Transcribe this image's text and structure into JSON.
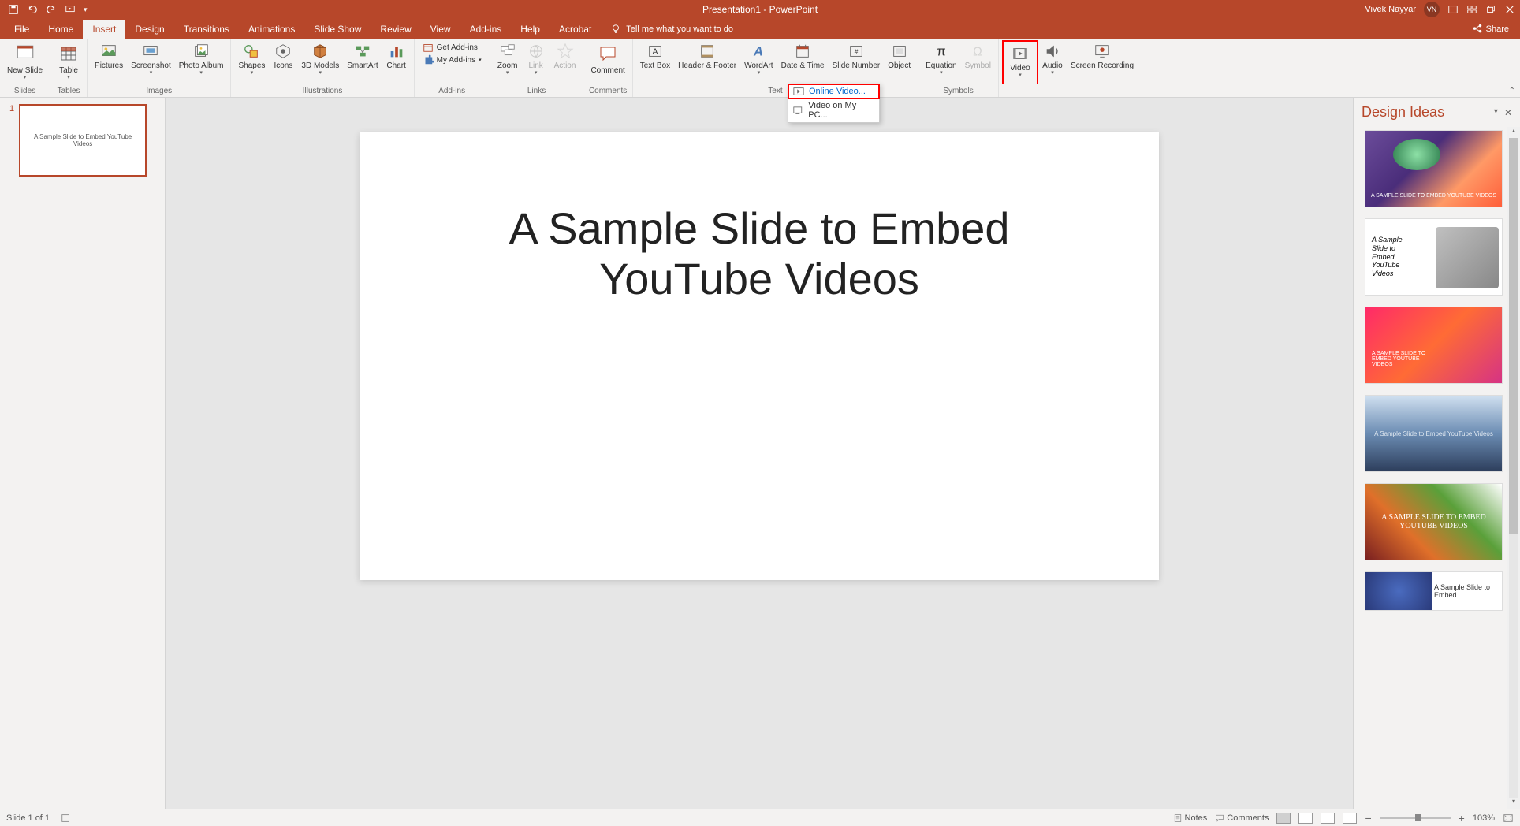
{
  "app": {
    "title": "Presentation1 - PowerPoint",
    "user": "Vivek Nayyar",
    "initials": "VN"
  },
  "qat": {
    "save": "Save",
    "undo": "Undo",
    "redo": "Redo",
    "start": "Start From Beginning"
  },
  "tabs": [
    "File",
    "Home",
    "Insert",
    "Design",
    "Transitions",
    "Animations",
    "Slide Show",
    "Review",
    "View",
    "Add-ins",
    "Help",
    "Acrobat"
  ],
  "active_tab": "Insert",
  "tellme": "Tell me what you want to do",
  "share": "Share",
  "ribbon_groups": {
    "slides": {
      "label": "Slides",
      "new_slide": "New\nSlide"
    },
    "tables": {
      "label": "Tables",
      "table": "Table"
    },
    "images": {
      "label": "Images",
      "pictures": "Pictures",
      "screenshot": "Screenshot",
      "photo_album": "Photo\nAlbum"
    },
    "illustrations": {
      "label": "Illustrations",
      "shapes": "Shapes",
      "icons": "Icons",
      "models3d": "3D\nModels",
      "smartart": "SmartArt",
      "chart": "Chart"
    },
    "addins": {
      "label": "Add-ins",
      "get": "Get Add-ins",
      "my": "My Add-ins"
    },
    "links": {
      "label": "Links",
      "zoom": "Zoom",
      "link": "Link",
      "action": "Action"
    },
    "comments": {
      "label": "Comments",
      "comment": "Comment"
    },
    "text": {
      "label": "Text",
      "textbox": "Text\nBox",
      "header": "Header\n& Footer",
      "wordart": "WordArt",
      "datetime": "Date &\nTime",
      "slidenum": "Slide\nNumber",
      "object": "Object"
    },
    "symbols": {
      "label": "Symbols",
      "equation": "Equation",
      "symbol": "Symbol"
    },
    "media": {
      "video": "Video",
      "audio": "Audio",
      "screen": "Screen\nRecording"
    }
  },
  "video_menu": {
    "online": "Online Video...",
    "pc": "Video on My PC..."
  },
  "slide": {
    "title": "A Sample Slide to Embed\nYouTube Videos",
    "thumb_text": "A Sample Slide to Embed YouTube Videos",
    "number": "1"
  },
  "design_ideas": {
    "title": "Design Ideas",
    "ideas": [
      "A SAMPLE SLIDE TO EMBED YOUTUBE VIDEOS",
      "A Sample Slide to Embed YouTube Videos",
      "A SAMPLE SLIDE TO EMBED YOUTUBE VIDEOS",
      "A Sample Slide to Embed YouTube Videos",
      "A SAMPLE SLIDE TO EMBED YOUTUBE VIDEOS",
      "A Sample Slide to Embed"
    ]
  },
  "status": {
    "slide": "Slide 1 of 1",
    "notes": "Notes",
    "comments": "Comments",
    "zoom": "103%"
  }
}
